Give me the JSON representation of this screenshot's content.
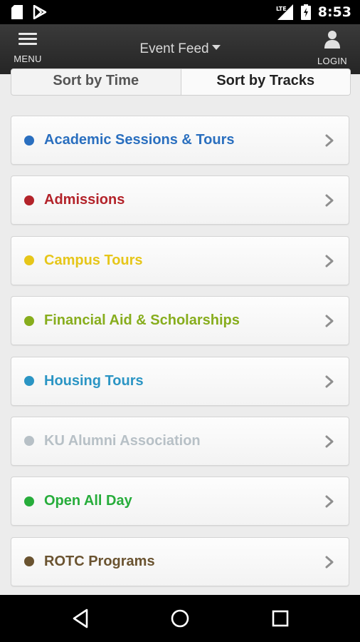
{
  "status_bar": {
    "time": "8:53",
    "network": "LTE",
    "icons": [
      "sd-card-icon",
      "play-store-icon",
      "signal-icon",
      "battery-icon"
    ]
  },
  "header": {
    "menu_label": "MENU",
    "title": "Event Feed",
    "login_label": "LOGIN"
  },
  "sort": {
    "by_time": "Sort by Time",
    "by_tracks": "Sort by Tracks",
    "active": "by_tracks"
  },
  "tracks": [
    {
      "label": "Academic Sessions & Tours",
      "color": "#2a6fbf"
    },
    {
      "label": "Admissions",
      "color": "#b3232a"
    },
    {
      "label": "Campus Tours",
      "color": "#e6c619"
    },
    {
      "label": "Financial Aid & Scholarships",
      "color": "#87ad1d"
    },
    {
      "label": "Housing Tours",
      "color": "#2b95c4"
    },
    {
      "label": "KU Alumni Association",
      "color": "#b7c0c6"
    },
    {
      "label": "Open All Day",
      "color": "#27ad3b"
    },
    {
      "label": "ROTC Programs",
      "color": "#6a5330"
    }
  ],
  "nav": {
    "icons": [
      "back-icon",
      "home-icon",
      "recents-icon"
    ]
  }
}
